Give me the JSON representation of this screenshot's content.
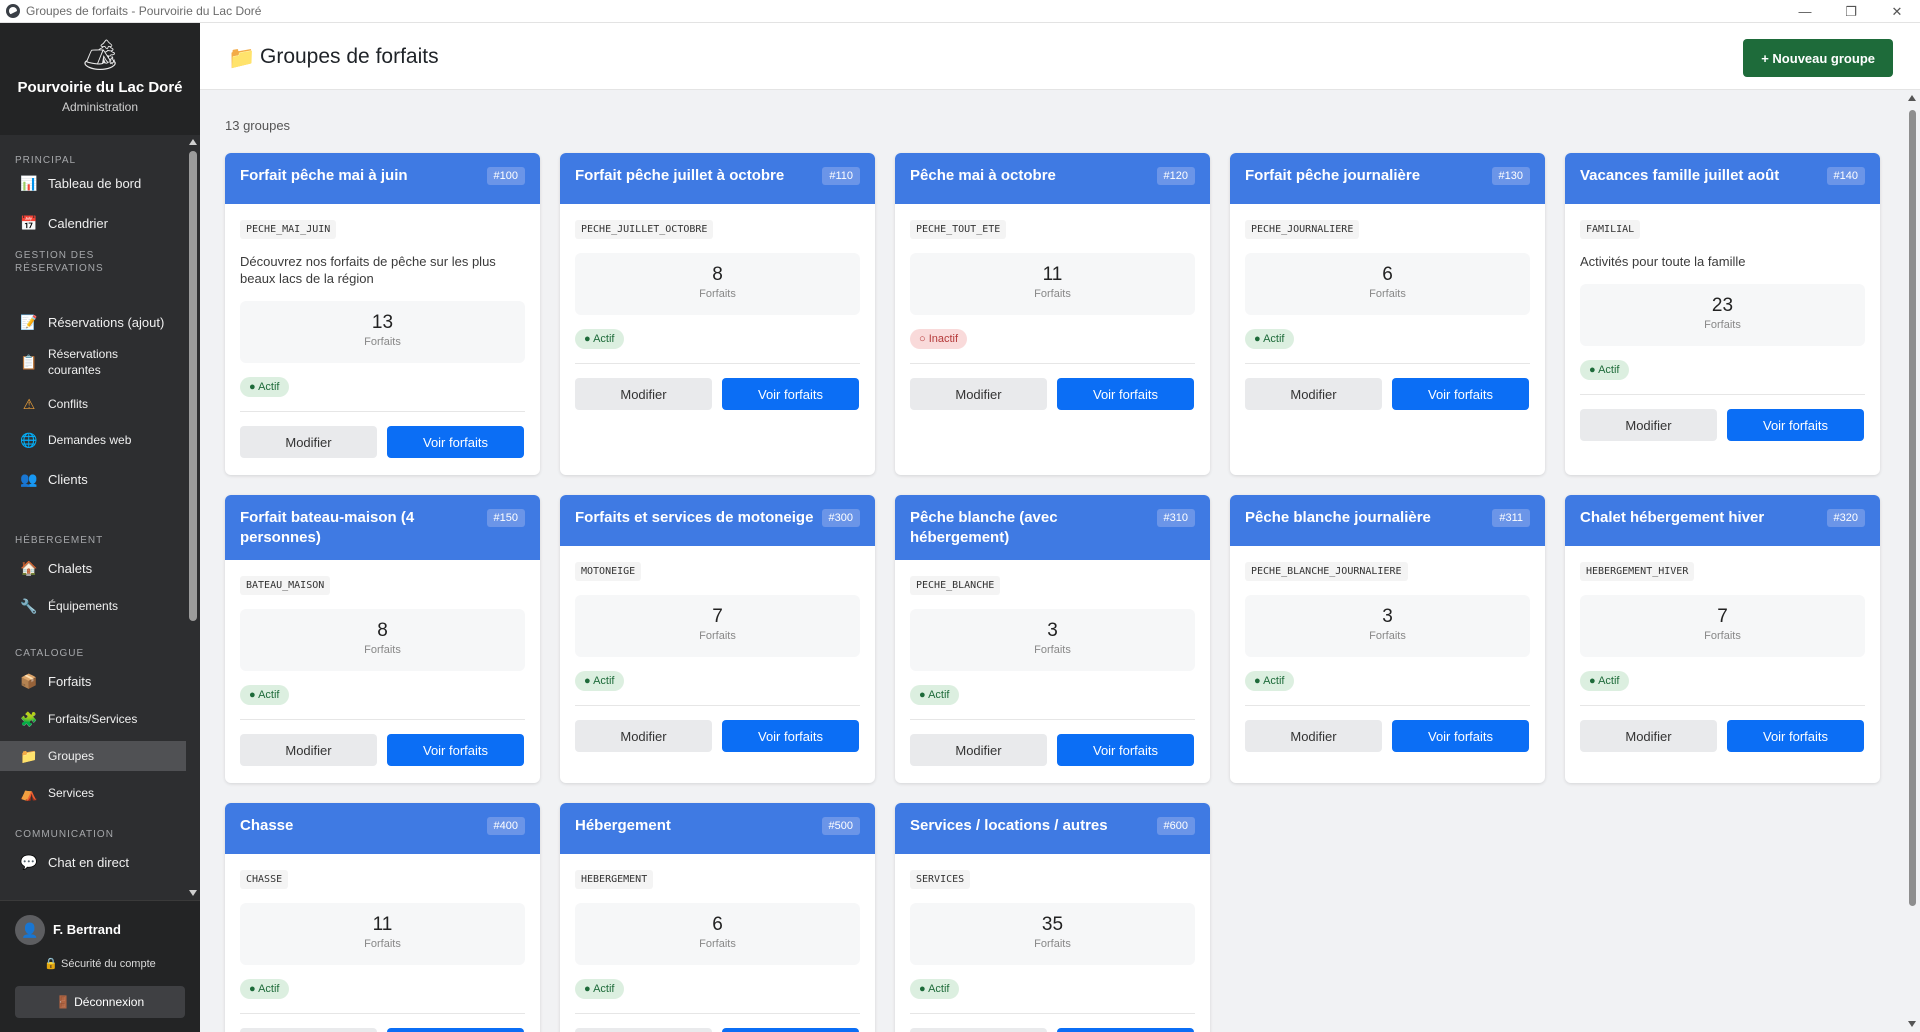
{
  "window": {
    "title": "Groupes de forfaits - Pourvoirie du Lac Doré",
    "minimize": "—",
    "maximize": "❐",
    "close": "✕"
  },
  "brand": {
    "logo": "🏕",
    "name": "Pourvoirie du Lac Doré",
    "subtitle": "Administration"
  },
  "sidebar": {
    "sections": {
      "principal": "PRINCIPAL",
      "gestion": "GESTION DES RÉSERVATIONS",
      "hebergement": "HÉBERGEMENT",
      "catalogue": "CATALOGUE",
      "communication": "COMMUNICATION"
    },
    "items": {
      "tableau": {
        "label": "Tableau de bord",
        "icon": "📊"
      },
      "calendrier": {
        "label": "Calendrier",
        "icon": "📅"
      },
      "reservations_ajout": {
        "label": "Réservations (ajout)",
        "icon": "📝"
      },
      "reservations_courantes": {
        "label": "Réservations courantes",
        "icon": "📋"
      },
      "conflits": {
        "label": "Conflits",
        "icon": "⚠"
      },
      "demandes": {
        "label": "Demandes web",
        "icon": "🌐"
      },
      "clients": {
        "label": "Clients",
        "icon": "👥"
      },
      "chalets": {
        "label": "Chalets",
        "icon": "🏠"
      },
      "equipements": {
        "label": "Équipements",
        "icon": "🔧"
      },
      "forfaits": {
        "label": "Forfaits",
        "icon": "📦"
      },
      "forfaits_services": {
        "label": "Forfaits/Services",
        "icon": "🧩"
      },
      "groupes": {
        "label": "Groupes",
        "icon": "📁"
      },
      "services": {
        "label": "Services",
        "icon": "⛺"
      },
      "chat": {
        "label": "Chat en direct",
        "icon": "💬"
      }
    }
  },
  "user": {
    "avatar": "👤",
    "name": "F. Bertrand",
    "security": "🔒 Sécurité du compte",
    "logout": "🚪 Déconnexion"
  },
  "header": {
    "icon": "📁",
    "title": "Groupes de forfaits",
    "new_button": "+ Nouveau groupe"
  },
  "main": {
    "count": "13 groupes"
  },
  "labels": {
    "forfaits": "Forfaits",
    "modifier": "Modifier",
    "voir": "Voir forfaits",
    "actif": "● Actif",
    "inactif": "○ Inactif"
  },
  "groups": [
    {
      "title": "Forfait pêche mai à juin",
      "id": "#100",
      "code": "PECHE_MAI_JUIN",
      "description": "Découvrez nos forfaits de pêche sur les plus beaux lacs de la région",
      "count": "13",
      "active": true
    },
    {
      "title": "Forfait pêche juillet à octobre",
      "id": "#110",
      "code": "PECHE_JUILLET_OCTOBRE",
      "description": "",
      "count": "8",
      "active": true
    },
    {
      "title": "Pêche mai à octobre",
      "id": "#120",
      "code": "PECHE_TOUT_ETE",
      "description": "",
      "count": "11",
      "active": false
    },
    {
      "title": "Forfait pêche journalière",
      "id": "#130",
      "code": "PECHE_JOURNALIERE",
      "description": "",
      "count": "6",
      "active": true
    },
    {
      "title": "Vacances famille juillet août",
      "id": "#140",
      "code": "FAMILIAL",
      "description": "Activités pour toute la famille",
      "count": "23",
      "active": true
    },
    {
      "title": "Forfait bateau-maison (4 personnes)",
      "id": "#150",
      "code": "BATEAU_MAISON",
      "description": "",
      "count": "8",
      "active": true
    },
    {
      "title": "Forfaits et services de motoneige",
      "id": "#300",
      "code": "MOTONEIGE",
      "description": "",
      "count": "7",
      "active": true
    },
    {
      "title": "Pêche blanche (avec hébergement)",
      "id": "#310",
      "code": "PECHE_BLANCHE",
      "description": "",
      "count": "3",
      "active": true
    },
    {
      "title": "Pêche blanche journalière",
      "id": "#311",
      "code": "PECHE_BLANCHE_JOURNALIERE",
      "description": "",
      "count": "3",
      "active": true
    },
    {
      "title": "Chalet hébergement hiver",
      "id": "#320",
      "code": "HEBERGEMENT_HIVER",
      "description": "",
      "count": "7",
      "active": true
    },
    {
      "title": "Chasse",
      "id": "#400",
      "code": "CHASSE",
      "description": "",
      "count": "11",
      "active": true
    },
    {
      "title": "Hébergement",
      "id": "#500",
      "code": "HEBERGEMENT",
      "description": "",
      "count": "6",
      "active": true
    },
    {
      "title": "Services / locations / autres",
      "id": "#600",
      "code": "SERVICES",
      "description": "",
      "count": "35",
      "active": true
    }
  ]
}
